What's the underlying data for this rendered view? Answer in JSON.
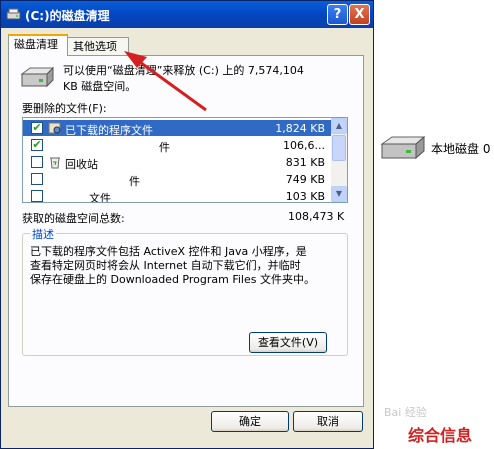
{
  "window": {
    "title": "(C:)的磁盘清理",
    "help_label": "?",
    "close_label": "X"
  },
  "tabs": [
    {
      "label": "磁盘清理",
      "active": true
    },
    {
      "label": "其他选项",
      "active": false
    }
  ],
  "info": {
    "line1": "可以使用“磁盘清理”来释放 (C:) 上的 7,574,104",
    "line2": "KB 磁盘空间。"
  },
  "files_label": "要删除的文件(F):",
  "files": [
    {
      "name": "已下载的程序文件",
      "size": "1,824 KB",
      "checked": true,
      "selected": true
    },
    {
      "name": "件",
      "size": "106,6...",
      "checked": true,
      "selected": false
    },
    {
      "name": "回收站",
      "size": "831 KB",
      "checked": false,
      "selected": false
    },
    {
      "name": "件",
      "size": "749 KB",
      "checked": false,
      "selected": false
    },
    {
      "name": "文件",
      "size": "103 KB",
      "checked": false,
      "selected": false
    }
  ],
  "total": {
    "label": "获取的磁盘空间总数:",
    "value": "108,473 K"
  },
  "description": {
    "title": "描述",
    "text": "已下载的程序文件包括 ActiveX 控件和 Java 小程序，是\n查看特定网页时将会从 Internet 自动下载它们，并临时\n保存在硬盘上的 Downloaded Program Files 文件夹中。"
  },
  "buttons": {
    "view_files": "查看文件(V)",
    "ok": "确定",
    "cancel": "取消"
  },
  "desktop": {
    "local_disk_label": "本地磁盘 0"
  },
  "watermark": {
    "baidu": "Bai 经验",
    "brand": "综合信息"
  },
  "colors": {
    "selection": "#316ac5",
    "title_bar": "#0348c4",
    "arrow": "#d42020",
    "brand": "#d21f1f"
  }
}
